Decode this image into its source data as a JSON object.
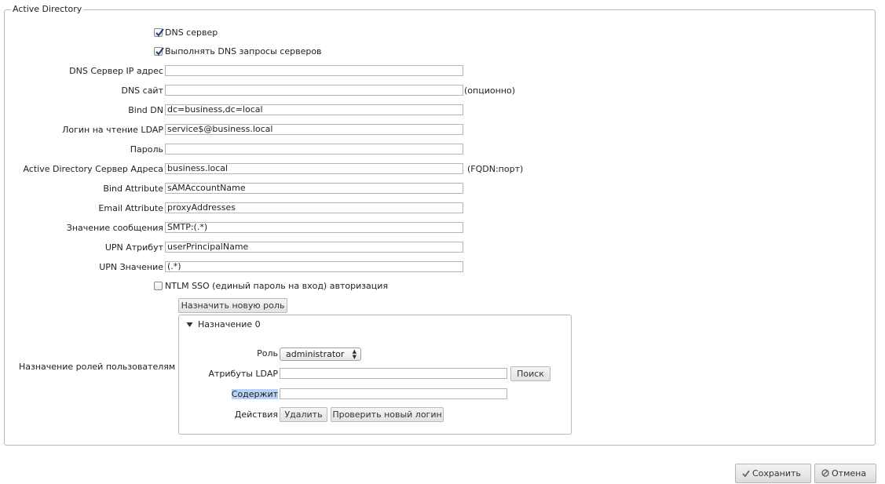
{
  "section": {
    "legend": "Active Directory"
  },
  "checkboxes": {
    "dns_server": {
      "label": "DNS сервер",
      "checked": true
    },
    "dns_queries": {
      "label": "Выполнять DNS запросы серверов",
      "checked": true
    },
    "ntlm_sso": {
      "label": "NTLM SSO (единый пароль на вход) авторизация",
      "checked": false
    }
  },
  "fields": {
    "dns_server_ip": {
      "label": "DNS Сервер IP адрес",
      "value": ""
    },
    "dns_site": {
      "label": "DNS сайт",
      "value": "",
      "suffix": "(опционно)"
    },
    "bind_dn": {
      "label": "Bind DN",
      "value": "dc=business,dc=local"
    },
    "ldap_login": {
      "label": "Логин на чтение LDAP",
      "value": "service$@business.local"
    },
    "password": {
      "label": "Пароль",
      "value": ""
    },
    "ad_server": {
      "label": "Active Directory Сервер Адреса",
      "value": "business.local",
      "suffix": "(FQDN:порт)"
    },
    "bind_attribute": {
      "label": "Bind Attribute",
      "value": "sAMAccountName"
    },
    "email_attribute": {
      "label": "Email Attribute",
      "value": "proxyAddresses"
    },
    "message_value": {
      "label": "Значение сообщения",
      "value": "SMTP:(.*)"
    },
    "upn_attribute": {
      "label": "UPN Атрибут",
      "value": "userPrincipalName"
    },
    "upn_value": {
      "label": "UPN Значение",
      "value": "(.*)"
    }
  },
  "roles": {
    "label": "Назначение ролей пользователям",
    "add_button": "Назначить новую роль",
    "assignment": {
      "title": "Назначение 0",
      "role_label": "Роль",
      "role_value": "administrator",
      "ldap_label": "Атрибуты LDAP",
      "ldap_value": "",
      "search_button": "Поиск",
      "contains_label": "Содержит",
      "contains_value": "",
      "actions_label": "Действия",
      "delete_button": "Удалить",
      "check_login_button": "Проверить новый логин"
    }
  },
  "footer": {
    "save_button": "Сохранить",
    "cancel_button": "Отмена"
  }
}
